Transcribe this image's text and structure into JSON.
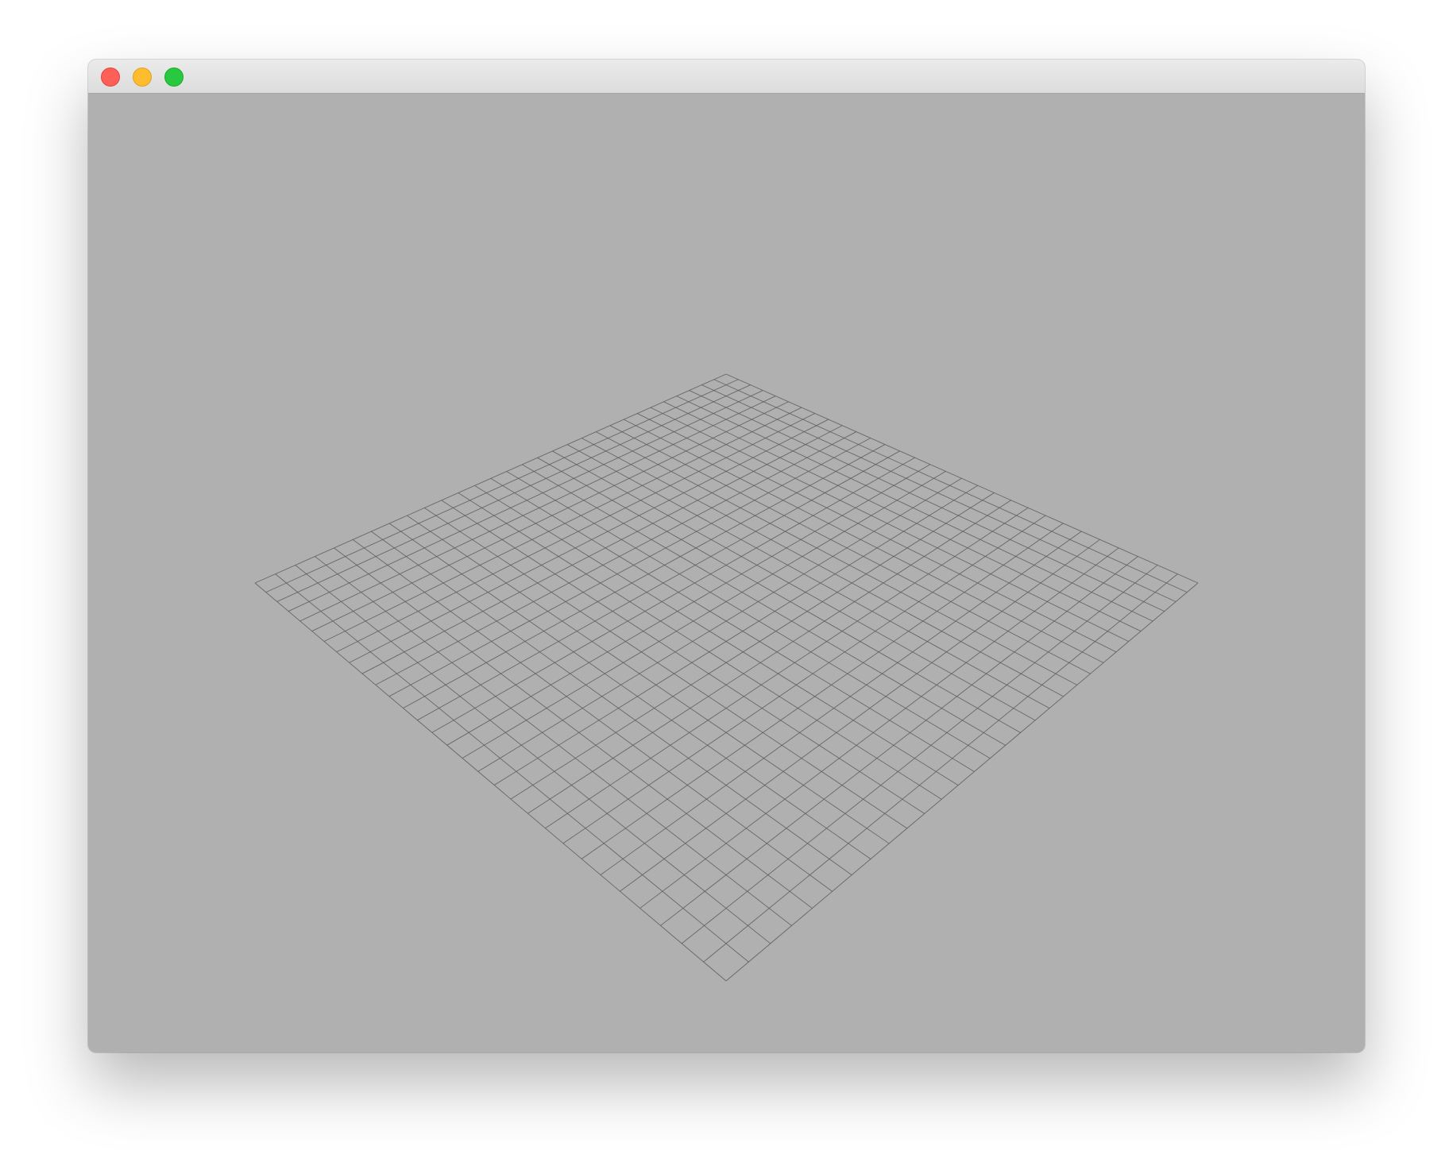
{
  "window": {
    "title": "",
    "background_color": "#b0b0b0",
    "titlebar_color": "#dcdcdc"
  },
  "controls": [
    {
      "name": "close-button",
      "icon": "close-icon",
      "color": "#fe5f57"
    },
    {
      "name": "minimize-button",
      "icon": "minimize-icon",
      "color": "#febc2e"
    },
    {
      "name": "zoom-button",
      "icon": "zoom-icon",
      "color": "#28c840"
    }
  ],
  "scene": {
    "object": "ground-plane-wireframe-grid",
    "grid_divisions": 30,
    "line_color": "#5a5a5a",
    "projection": "perspective"
  }
}
